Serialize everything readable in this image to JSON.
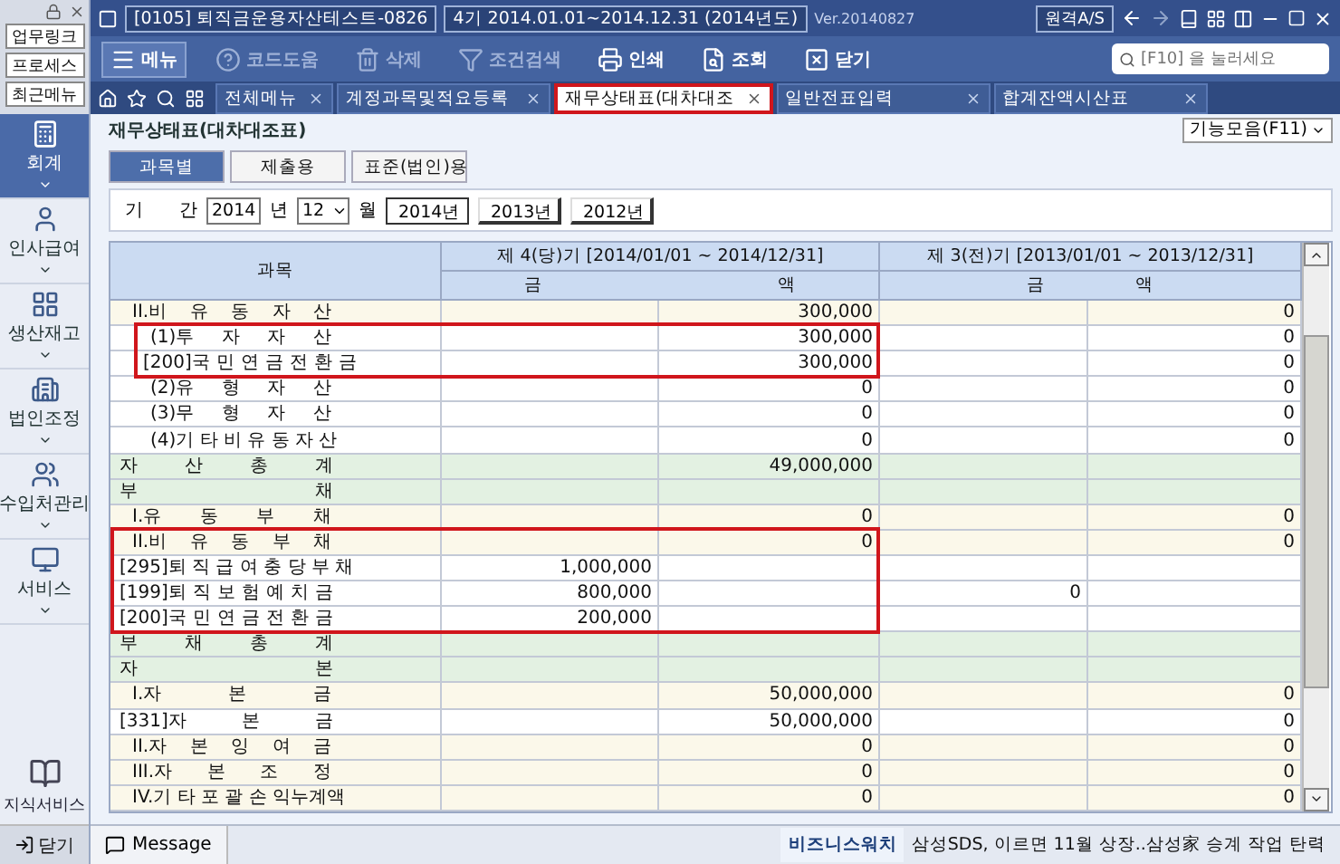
{
  "sidebar": {
    "top_buttons": [
      "업무링크",
      "프로세스",
      "최근메뉴"
    ],
    "items": [
      {
        "label": "회계",
        "selected": true
      },
      {
        "label": "인사급여",
        "selected": false
      },
      {
        "label": "생산재고",
        "selected": false
      },
      {
        "label": "법인조정",
        "selected": false
      },
      {
        "label": "수입처관리",
        "selected": false
      },
      {
        "label": "서비스",
        "selected": false
      }
    ],
    "knowledge": "지식서비스",
    "close": "닫기"
  },
  "title_bar": {
    "company": "[0105] 퇴직금운용자산테스트-0826",
    "period": "4기 2014.01.01~2014.12.31 (2014년도)",
    "version": "Ver.20140827",
    "remote": "원격A/S"
  },
  "toolbar": {
    "items": [
      {
        "label": "메뉴",
        "disabled": false
      },
      {
        "label": "코드도움",
        "disabled": true
      },
      {
        "label": "삭제",
        "disabled": true
      },
      {
        "label": "조건검색",
        "disabled": true
      },
      {
        "label": "인쇄",
        "disabled": false
      },
      {
        "label": "조회",
        "disabled": false
      },
      {
        "label": "닫기",
        "disabled": false
      }
    ],
    "search_placeholder": "[F10] 을 눌러세요"
  },
  "tabs": [
    {
      "label": "전체메뉴",
      "selected": false,
      "highlighted": false
    },
    {
      "label": "계정과목및적요등록",
      "selected": false,
      "highlighted": false
    },
    {
      "label": "재무상태표(대차대조",
      "selected": true,
      "highlighted": true
    },
    {
      "label": "일반전표입력",
      "selected": false,
      "highlighted": false
    },
    {
      "label": "합계잔액시산표",
      "selected": false,
      "highlighted": false
    }
  ],
  "page_title": "재무상태표(대차대조표)",
  "function_menu": "기능모음(F11)",
  "view_tabs": [
    {
      "label": "과목별",
      "selected": true
    },
    {
      "label": "제출용",
      "selected": false
    },
    {
      "label": "표준(법인)용",
      "selected": false
    }
  ],
  "period": {
    "label": "기 간",
    "year": "2014",
    "year_unit": "년",
    "month": "12",
    "month_unit": "월",
    "year_buttons": [
      {
        "label": "2014년",
        "selected": true
      },
      {
        "label": "2013년",
        "selected": false
      },
      {
        "label": "2012년",
        "selected": false
      }
    ]
  },
  "table": {
    "account_header": "과목",
    "current_header": "제 4(당)기 [2014/01/01 ~ 2014/12/31]",
    "prior_header": "제 3(전)기 [2013/01/01 ~ 2013/12/31]",
    "amount_header": "금 액",
    "amount_header_prior": "금 액",
    "rows": [
      {
        "kind": "group",
        "label": "II.비 유 동 자 산",
        "current_2": "300,000",
        "prior_2": "0",
        "highlighted": false
      },
      {
        "kind": "sub",
        "label": "(1)투 자 자 산",
        "current_2": "300,000",
        "prior_2": "0",
        "highlighted": true
      },
      {
        "kind": "sub_account",
        "label": "[200]국 민 연 금 전 환 금",
        "current_2": "300,000",
        "prior_2": "0",
        "highlighted": true
      },
      {
        "kind": "sub",
        "label": "(2)유 형 자 산",
        "current_2": "0",
        "prior_2": "0",
        "highlighted": false
      },
      {
        "kind": "sub",
        "label": "(3)무 형 자 산",
        "current_2": "0",
        "prior_2": "0",
        "highlighted": false
      },
      {
        "kind": "sub",
        "label": "(4)기 타 비 유 동 자 산",
        "current_2": "0",
        "prior_2": "0",
        "highlighted": false
      },
      {
        "kind": "total",
        "label": "자 산 총 계",
        "current_2": "49,000,000",
        "highlighted": false
      },
      {
        "kind": "total",
        "label": "부 채",
        "highlighted": false
      },
      {
        "kind": "group",
        "label": "I.유 동 부 채",
        "current_2": "0",
        "prior_2": "0",
        "highlighted": false
      },
      {
        "kind": "group",
        "label": "II.비 유 동 부 채",
        "current_2": "0",
        "prior_2": "0",
        "highlighted": true
      },
      {
        "kind": "account",
        "label": "[295]퇴 직 급 여 충 당 부 채",
        "current_1": "1,000,000",
        "highlighted": true
      },
      {
        "kind": "account",
        "label": "[199]퇴 직 보 험 예 치 금",
        "current_1": "800,000",
        "prior_1": "0",
        "highlighted": true
      },
      {
        "kind": "account",
        "label": "[200]국 민 연 금 전 환 금",
        "current_1": "200,000",
        "highlighted": true
      },
      {
        "kind": "total",
        "label": "부 채 총 계",
        "highlighted": false
      },
      {
        "kind": "total",
        "label": "자 본",
        "highlighted": false
      },
      {
        "kind": "group",
        "label": "I.자 본 금",
        "current_2": "50,000,000",
        "prior_2": "0",
        "highlighted": false
      },
      {
        "kind": "account",
        "label": "[331]자 본 금",
        "current_2": "50,000,000",
        "prior_2": "0",
        "highlighted": false
      },
      {
        "kind": "group",
        "label": "II.자 본 잉 여 금",
        "current_2": "0",
        "prior_2": "0",
        "highlighted": false
      },
      {
        "kind": "group",
        "label": "III.자 본 조 정",
        "current_2": "0",
        "prior_2": "0",
        "highlighted": false
      },
      {
        "kind": "group",
        "label": "IV.기 타 포 괄 손 익누계액",
        "current_2": "0",
        "prior_2": "0",
        "highlighted": false
      }
    ]
  },
  "status_bar": {
    "message": "Message",
    "news_label": "비즈니스워치",
    "news": "삼성SDS, 이르면 11월 상장..삼성家 승계 작업 탄력"
  }
}
